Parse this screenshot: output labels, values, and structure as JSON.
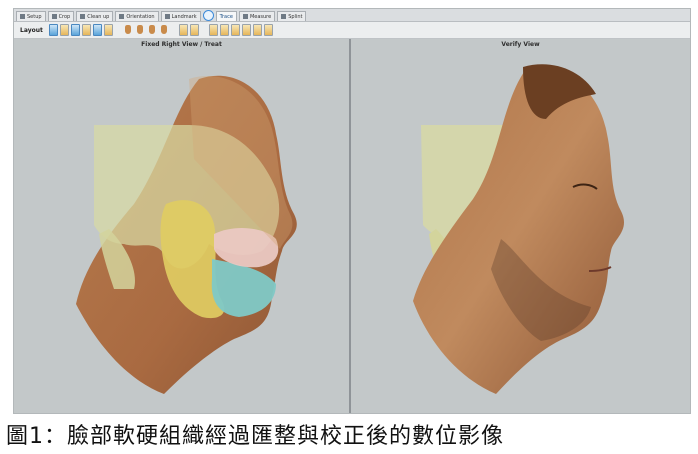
{
  "tabs": [
    {
      "label": "Setup"
    },
    {
      "label": "Crop"
    },
    {
      "label": "Clean up"
    },
    {
      "label": "Orientation"
    },
    {
      "label": "Landmark"
    },
    {
      "label": "Trace"
    },
    {
      "label": "Measure"
    },
    {
      "label": "Splint"
    }
  ],
  "toolbar": {
    "layout_label": "Layout"
  },
  "views": {
    "left_title": "Fixed Right View / Treat",
    "right_title": "Verify View"
  },
  "caption": "圖1：臉部軟硬組織經過匯整與校正後的數位影像"
}
